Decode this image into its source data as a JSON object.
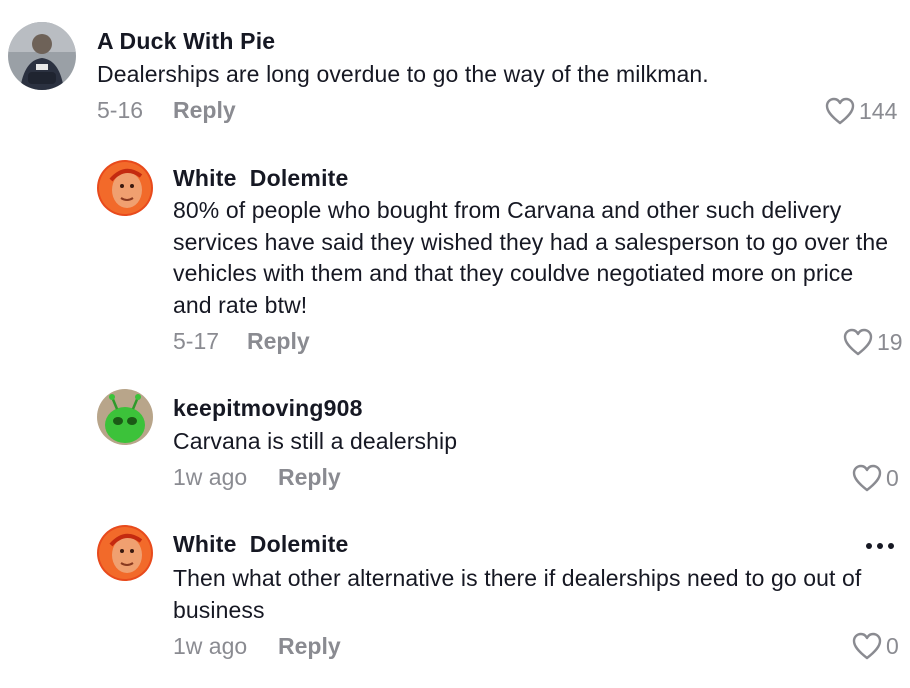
{
  "comments": [
    {
      "username": "A Duck With Pie",
      "text": "Dealerships are long overdue to go the way of the milkman.",
      "date": "5-16",
      "reply_label": "Reply",
      "likes": "144",
      "avatar_icon": "person-photo-avatar"
    },
    {
      "username": "White  Dolemite",
      "text": "80% of people who bought from Carvana and other such delivery services have said they wished they had a salesperson to go over the vehicles with them and that they couldve negotiated more on price and rate btw!",
      "date": "5-17",
      "reply_label": "Reply",
      "likes": "19",
      "avatar_icon": "orange-face-avatar"
    },
    {
      "username": "keepitmoving908",
      "text": "Carvana is still a dealership",
      "date": "1w ago",
      "reply_label": "Reply",
      "likes": "0",
      "avatar_icon": "green-alien-avatar"
    },
    {
      "username": "White  Dolemite",
      "text": "Then what other alternative is there if dealerships need to go out of business",
      "date": "1w ago",
      "reply_label": "Reply",
      "likes": "0",
      "avatar_icon": "orange-face-avatar"
    }
  ],
  "colors": {
    "text_primary": "#161823",
    "text_secondary": "#8a8b91",
    "background": "#ffffff"
  }
}
